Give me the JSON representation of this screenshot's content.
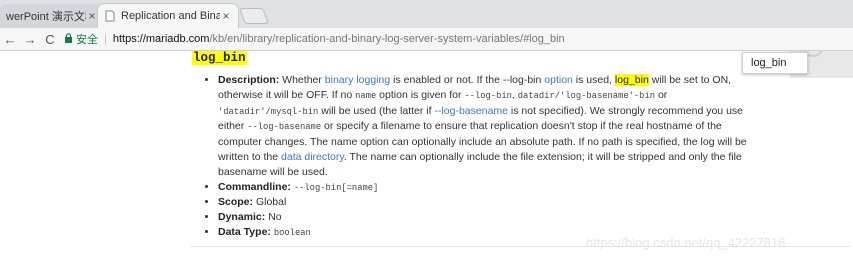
{
  "browser": {
    "tabs": [
      {
        "label": "werPoint 演示文稿",
        "close": "×"
      },
      {
        "label": "Replication and Binary",
        "close": "×"
      }
    ],
    "nav": {
      "back": "←",
      "forward": "→",
      "reload": "C"
    },
    "address": {
      "secure_label": "安全",
      "separator": "|",
      "host": "https://mariadb.com",
      "path": "/kb/en/library/replication-and-binary-log-server-system-variables/#log_bin"
    },
    "find_box": {
      "value": "log_bin"
    }
  },
  "page": {
    "heading": "log_bin",
    "description": {
      "label": "Description:",
      "t1": " Whether ",
      "link_binary_logging": "binary logging",
      "t2": " is enabled or not. If the --log-bin ",
      "link_option": "option",
      "t3": " is used, ",
      "highlight": "log_bin",
      "t4": " will be set to ON, otherwise it will be OFF. If no ",
      "code_name": "name",
      "t5": " option is given for ",
      "code_a": "--log-bin",
      "t6": ", ",
      "code_b": "datadir/'log-basename'-bin",
      "t7": " or ",
      "code_c": "'datadir'/mysql-bin",
      "t8": " will be used (the latter if ",
      "link_log_basename": "--log-basename",
      "t9": " is not specified). We strongly recommend you use either ",
      "code_d": "--log-basename",
      "t10": " or specify a filename to ensure that replication doesn't stop if the real hostname of the computer changes. The name option can optionally include an absolute path. If no path is specified, the log will be written to the ",
      "link_data_directory": "data directory",
      "t11": ". The name can optionally include the file extension; it will be stripped and only the file basename will be used."
    },
    "commandline": {
      "label": "Commandline:",
      "value": "--log-bin[=name]"
    },
    "scope": {
      "label": "Scope:",
      "value": "Global"
    },
    "dynamic": {
      "label": "Dynamic:",
      "value": "No"
    },
    "data_type": {
      "label": "Data Type:",
      "value": "boolean"
    },
    "watermark": "https://blog.csdn.net/qq_42227818"
  }
}
